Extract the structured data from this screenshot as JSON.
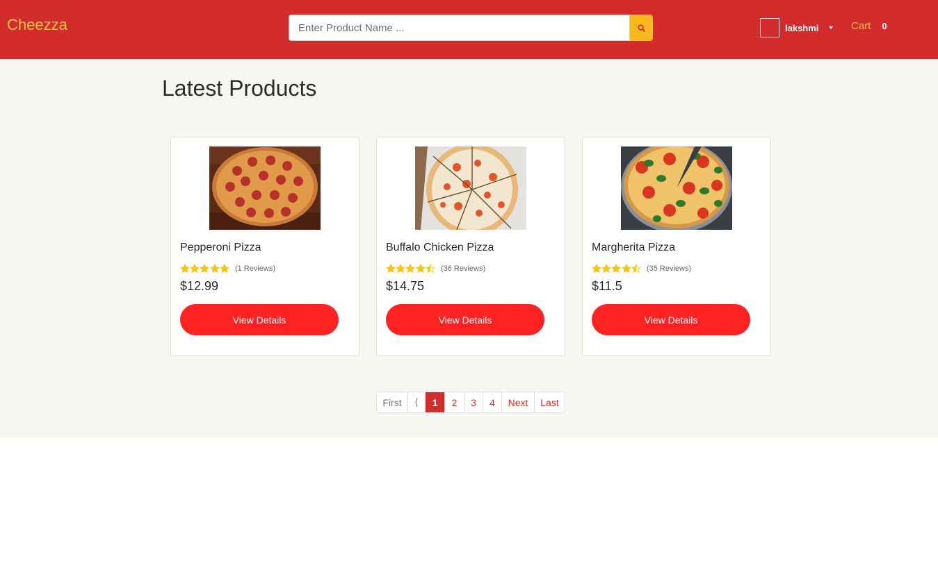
{
  "navbar": {
    "brand": "Cheezza",
    "search": {
      "placeholder": "Enter Product Name ...",
      "value": ""
    },
    "user": {
      "name": "lakshmi"
    },
    "cart": {
      "label": "Cart",
      "count": "0"
    },
    "colors": {
      "bar": "#d32c2c",
      "accent": "#f8c34a",
      "search_button": "#f8b81f"
    }
  },
  "main": {
    "heading": "Latest Products",
    "products": [
      {
        "name": "Pepperoni Pizza",
        "rating": 5,
        "reviews": "(1 Reviews)",
        "price": "$12.99",
        "button": "View Details"
      },
      {
        "name": "Buffalo Chicken Pizza",
        "rating": 4.5,
        "reviews": "(36 Reviews)",
        "price": "$14.75",
        "button": "View Details"
      },
      {
        "name": "Margherita Pizza",
        "rating": 4.5,
        "reviews": "(35 Reviews)",
        "price": "$11.5",
        "button": "View Details"
      }
    ]
  },
  "pagination": {
    "first": "First",
    "prev": "⟨",
    "pages": [
      "1",
      "2",
      "3",
      "4"
    ],
    "current": "1",
    "next": "Next",
    "last": "Last"
  }
}
